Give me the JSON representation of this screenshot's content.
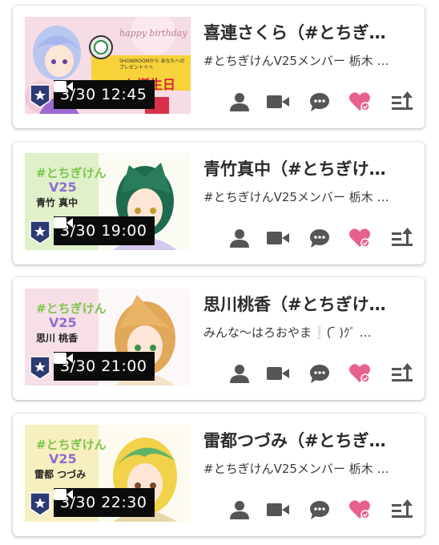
{
  "cards": [
    {
      "title": "喜連さくら（#とちぎ…",
      "subtitle": "#とちぎけんV25メンバー 栃木 …",
      "time": "3/30 12:45",
      "thumb_text": "お誕生日",
      "thumb_caption": "SHOWROOMから あなたへのプレゼントイベ",
      "script_text": "happy birthday",
      "thumb_bg": "#f6d9e0"
    },
    {
      "title": "青竹真中（#とちぎけ…",
      "subtitle": "#とちぎけんV25メンバー 栃木 …",
      "time": "3/30 19:00",
      "thumb_name": "青竹 真中",
      "thumb_bg": "#e0f0c8"
    },
    {
      "title": "思川桃香（#とちぎけ…",
      "subtitle": "みんな〜はろおやま❕( ᷇ )ｸﾞ …",
      "time": "3/30 21:00",
      "thumb_name": "思川 桃香",
      "thumb_bg": "#f6dfe6"
    },
    {
      "title": "雷都つづみ（#とちぎ…",
      "subtitle": "#とちぎけんV25メンバー 栃木 …",
      "time": "3/30 22:30",
      "thumb_name": "雷都 つづみ",
      "thumb_bg": "#f8efc0"
    }
  ],
  "icons": [
    "person-icon",
    "video-camera-icon",
    "chat-bubble-icon",
    "heart-check-icon",
    "sort-up-icon"
  ],
  "colors": {
    "icon_gray": "#555555",
    "heart_pink": "#e8618c",
    "time_bg": "#0b0b0b",
    "pin_navy": "#2e3a73"
  }
}
